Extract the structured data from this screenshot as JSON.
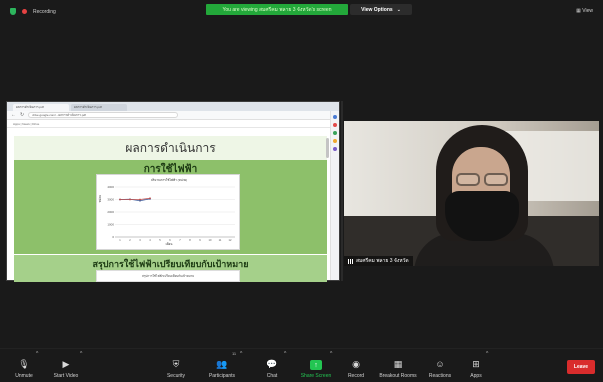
{
  "topbar": {
    "recording_label": "Recording",
    "banner_text": "You are viewing สมศรีคม พลาย 3 จังหวัด's screen",
    "view_options_label": "View Options",
    "view_label": "View"
  },
  "shared_screen": {
    "tabs": [
      "ผลการดำเนินการ.pdf",
      "ผลการดำเนินการ.pdf"
    ],
    "url": "drive.google.com/...ผลการดำเนินการ.pdf",
    "bookmarks": "Apps  |  News  |  Drive",
    "slide_title": "ผลการดำเนินการ",
    "slide_subtitle": "การใช้ไฟฟ้า",
    "chart_title": "ปริมาณการใช้ไฟฟ้า (หน่วย)",
    "chart_ylabel": "หน่วย",
    "chart_xlabel": "เดือน",
    "summary_title": "สรุปการใช้ไฟฟ้าเปรียบเทียบกับเป้าหมาย",
    "summary_card_text": "สรุปการใช้ไฟฟ้าเปรียบเทียบกับเป้าหมาย"
  },
  "chart_data": {
    "type": "line",
    "title": "ปริมาณการใช้ไฟฟ้า (หน่วย)",
    "ylabel": "หน่วย",
    "xlabel": "เดือน",
    "categories": [
      "1",
      "2",
      "3",
      "4",
      "5",
      "6",
      "7",
      "8",
      "9",
      "10",
      "11",
      "12"
    ],
    "series": [
      {
        "values": [
          3000,
          3020,
          2900,
          3050,
          null,
          null,
          null,
          null,
          null,
          null,
          null,
          null
        ],
        "color": "#3a5a9a"
      },
      {
        "values": [
          3000,
          3000,
          3000,
          3100,
          null,
          null,
          null,
          null,
          null,
          null,
          null,
          null
        ],
        "color": "#c0504d"
      }
    ],
    "ylim": [
      0,
      4000
    ],
    "grid": true
  },
  "video": {
    "participant_name": "สมศรีคม พลาย 3 จังหวัด"
  },
  "toolbar": {
    "unmute": "Unmute",
    "start_video": "Start Video",
    "security": "Security",
    "participants": "Participants",
    "participants_count": "11",
    "chat": "Chat",
    "share_screen": "Share Screen",
    "record": "Record",
    "breakout_rooms": "Breakout Rooms",
    "reactions": "Reactions",
    "apps": "Apps",
    "leave": "Leave"
  },
  "colors": {
    "banner": "#23a83a",
    "leave": "#d92c2c",
    "share": "#23c552",
    "slide_green": "#8dc06a"
  }
}
